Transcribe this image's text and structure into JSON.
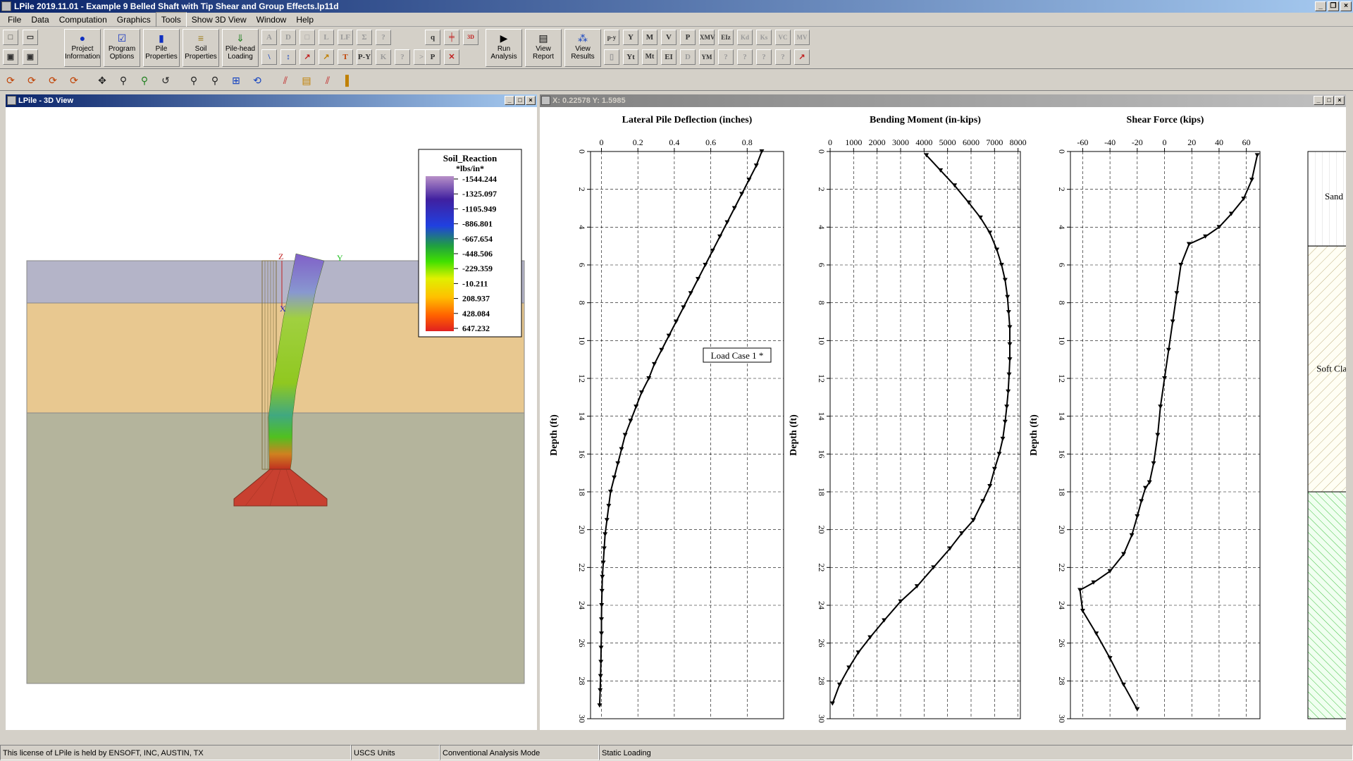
{
  "window": {
    "title": "LPile 2019.11.01 - Example 9 Belled Shaft with Tip Shear and Group Effects.lp11d"
  },
  "menu": {
    "items": [
      "File",
      "Data",
      "Computation",
      "Graphics",
      "Tools",
      "Show 3D View",
      "Window",
      "Help"
    ],
    "active": "Tools"
  },
  "toolbar": {
    "project_info": [
      "Project",
      "Information"
    ],
    "program_options": [
      "Program",
      "Options"
    ],
    "pile_properties": [
      "Pile",
      "Properties"
    ],
    "soil_properties": [
      "Soil",
      "Properties"
    ],
    "pilehead_loading": [
      "Pile-head",
      "Loading"
    ],
    "run_analysis": [
      "Run",
      "Analysis"
    ],
    "view_report": [
      "View",
      "Report"
    ],
    "view_results": [
      "View",
      "Results"
    ]
  },
  "view3d": {
    "title": "LPile - 3D View",
    "axis_labels": {
      "z": "Z",
      "y": "Y",
      "x": "X"
    },
    "legend": {
      "title": "Soil_Reaction",
      "units": "*lbs/in*",
      "values": [
        "-1544.244",
        "-1325.097",
        "-1105.949",
        "-886.801",
        "-667.654",
        "-448.506",
        "-229.359",
        "-10.211",
        "208.937",
        "428.084",
        "647.232"
      ]
    },
    "colors": {
      "sand": "#b4b4c8",
      "soft_clay": "#e8c890",
      "stiff": "#b4b49c",
      "border": "#888888"
    }
  },
  "results": {
    "coord_readout": "X: 0.22578 Y: 1.5985",
    "load_case_label": "Load Case 1 *",
    "depth_label": "Depth (ft)",
    "soil_layers": [
      {
        "name": "Sand",
        "top": 0,
        "bottom": 5
      },
      {
        "name": "Soft Clay",
        "top": 5,
        "bottom": 18
      },
      {
        "name": "",
        "top": 18,
        "bottom": 30
      }
    ]
  },
  "chart_data": [
    {
      "type": "line",
      "title": "Lateral Pile Deflection (inches)",
      "xlabel": "Lateral Pile Deflection (inches)",
      "ylabel": "Depth (ft)",
      "xlim": [
        -0.06,
        1.0
      ],
      "ylim": [
        30,
        0
      ],
      "xticks": [
        "0",
        "0.2",
        "0.4",
        "0.6",
        "0.8"
      ],
      "yticks": [
        "0",
        "2",
        "4",
        "6",
        "8",
        "10",
        "12",
        "14",
        "16",
        "18",
        "20",
        "22",
        "24",
        "26",
        "28",
        "30"
      ],
      "x": [
        0.88,
        0.85,
        0.81,
        0.77,
        0.73,
        0.69,
        0.65,
        0.61,
        0.57,
        0.53,
        0.49,
        0.45,
        0.41,
        0.37,
        0.33,
        0.29,
        0.26,
        0.22,
        0.19,
        0.16,
        0.13,
        0.11,
        0.09,
        0.07,
        0.05,
        0.04,
        0.03,
        0.02,
        0.015,
        0.01,
        0.005,
        0.003,
        0.001,
        0.0,
        0.0,
        -0.002,
        -0.003,
        -0.005,
        -0.007,
        -0.01
      ],
      "y": [
        0,
        0.75,
        1.5,
        2.25,
        3.0,
        3.75,
        4.5,
        5.25,
        6.0,
        6.75,
        7.5,
        8.25,
        9.0,
        9.75,
        10.5,
        11.25,
        12.0,
        12.75,
        13.5,
        14.25,
        15.0,
        15.75,
        16.5,
        17.25,
        18.0,
        18.75,
        19.5,
        20.25,
        21.0,
        21.75,
        22.5,
        23.25,
        24.0,
        24.75,
        25.5,
        26.25,
        27.0,
        27.75,
        28.5,
        29.3
      ],
      "grid": true
    },
    {
      "type": "line",
      "title": "Bending Moment (in-kips)",
      "xlabel": "Bending Moment (in-kips)",
      "ylabel": "Depth (ft)",
      "xlim": [
        0,
        8100
      ],
      "ylim": [
        30,
        0
      ],
      "xticks": [
        "0",
        "1000",
        "2000",
        "3000",
        "4000",
        "5000",
        "6000",
        "7000",
        "8000"
      ],
      "yticks": [
        "0",
        "2",
        "4",
        "6",
        "8",
        "10",
        "12",
        "14",
        "16",
        "18",
        "20",
        "22",
        "24",
        "26",
        "28",
        "30"
      ],
      "x": [
        4100,
        4700,
        5300,
        5900,
        6400,
        6800,
        7100,
        7300,
        7450,
        7550,
        7600,
        7650,
        7650,
        7650,
        7620,
        7580,
        7520,
        7450,
        7350,
        7200,
        7000,
        6800,
        6500,
        6100,
        5600,
        5100,
        4400,
        3700,
        3000,
        2300,
        1700,
        1200,
        800,
        400,
        100
      ],
      "y": [
        0.2,
        1.0,
        1.8,
        2.7,
        3.5,
        4.3,
        5.2,
        6.0,
        6.8,
        7.7,
        8.5,
        9.3,
        10.2,
        11.0,
        11.8,
        12.7,
        13.5,
        14.3,
        15.2,
        16.0,
        16.8,
        17.7,
        18.5,
        19.5,
        20.2,
        21.0,
        22.0,
        23.0,
        23.8,
        24.8,
        25.7,
        26.5,
        27.3,
        28.2,
        29.2
      ],
      "grid": true
    },
    {
      "type": "line",
      "title": "Shear Force (kips)",
      "xlabel": "Shear Force (kips)",
      "ylabel": "Depth (ft)",
      "xlim": [
        -69,
        70
      ],
      "ylim": [
        30,
        0
      ],
      "xticks": [
        "-60",
        "-40",
        "-20",
        "0",
        "20",
        "40",
        "60"
      ],
      "yticks": [
        "0",
        "2",
        "4",
        "6",
        "8",
        "10",
        "12",
        "14",
        "16",
        "18",
        "20",
        "22",
        "24",
        "26",
        "28",
        "30"
      ],
      "x": [
        68,
        64,
        58,
        49,
        40,
        30,
        18,
        12,
        9,
        6,
        3,
        0,
        -3,
        -5,
        -8,
        -11,
        -14,
        -17,
        -20,
        -24,
        -30,
        -40,
        -52,
        -62,
        -60,
        -50,
        -40,
        -30,
        -20
      ],
      "y": [
        0.2,
        1.5,
        2.5,
        3.3,
        4.0,
        4.5,
        4.9,
        6.0,
        7.5,
        9.0,
        10.5,
        12.0,
        13.5,
        15.0,
        16.5,
        17.5,
        17.8,
        18.5,
        19.3,
        20.3,
        21.3,
        22.2,
        22.8,
        23.2,
        24.3,
        25.5,
        26.8,
        28.2,
        29.5
      ],
      "grid": true
    }
  ],
  "status": {
    "license": "This license of LPile is held by ENSOFT, INC, AUSTIN, TX",
    "units": "USCS Units",
    "mode": "Conventional Analysis Mode",
    "loading": "Static Loading"
  }
}
